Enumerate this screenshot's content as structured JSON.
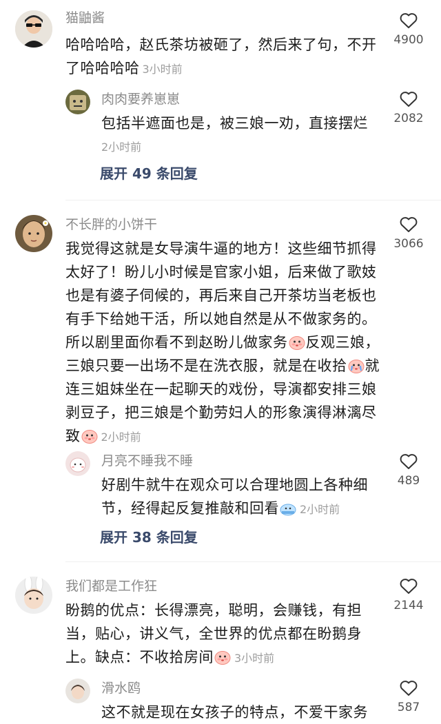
{
  "comments": [
    {
      "username": "猫鼬酱",
      "text_line1": "哈哈哈哈，赵氏茶坊被砸了，然后来了句，不开",
      "text_line2": "了哈哈哈哈",
      "time": "3小时前",
      "likes": "4900",
      "reply": {
        "username": "肉肉要养崽崽",
        "text": "包括半遮面也是，被三娘一劝，直接摆烂",
        "time": "2小时前",
        "likes": "2082"
      },
      "expand_label": "展开 49 条回复"
    },
    {
      "username": "不长胖的小饼干",
      "lines": [
        "我觉得这就是女导演牛逼的地方！这些细节抓得",
        "太好了！盼儿小时候是官家小姐，后来做了歌妓",
        "也是有婆子伺候的，再后来自己开茶坊当老板也",
        "有手下给她干活，所以她自然是从不做家务的。"
      ],
      "line5a": "所以剧里面你看不到赵盼儿做家务",
      "line5b": "反观三娘，",
      "line6a": "三娘只要一出场不是在洗衣服，就是在收拾",
      "line6b": "就",
      "line7": "连三姐妹坐在一起聊天的戏份，导演都安排三娘",
      "line8": "剥豆子，把三娘是个勤劳妇人的形象演得淋漓尽",
      "line9": "致",
      "time": "2小时前",
      "likes": "3066",
      "reply": {
        "username": "月亮不睡我不睡",
        "text_line1": "好剧牛就牛在观众可以合理地圆上各种细",
        "text_line2": "节，经得起反复推敲和回看",
        "time": "2小时前",
        "likes": "489"
      },
      "expand_label": "展开 38 条回复"
    },
    {
      "username": "我们都是工作狂",
      "text_line1": "盼鹅的优点：长得漂亮，聪明，会赚钱，有担",
      "text_line2": "当，贴心，讲义气，全世界的优点都在盼鹅身",
      "text_line3": "上。缺点：不收拾房间",
      "time": "3小时前",
      "likes": "2144",
      "reply": {
        "username": "滑水鸥",
        "text": "这不就是现在女孩子的特点，不爱干家务",
        "likes": "587"
      }
    }
  ],
  "colors": {
    "expand": "#3a4a6b",
    "username": "#8b8b8b",
    "time": "#9d9d9d"
  },
  "icons": [
    "heart-outline-icon",
    "flushed-face-emoji",
    "crying-face-emoji",
    "cold-sweat-emoji"
  ]
}
